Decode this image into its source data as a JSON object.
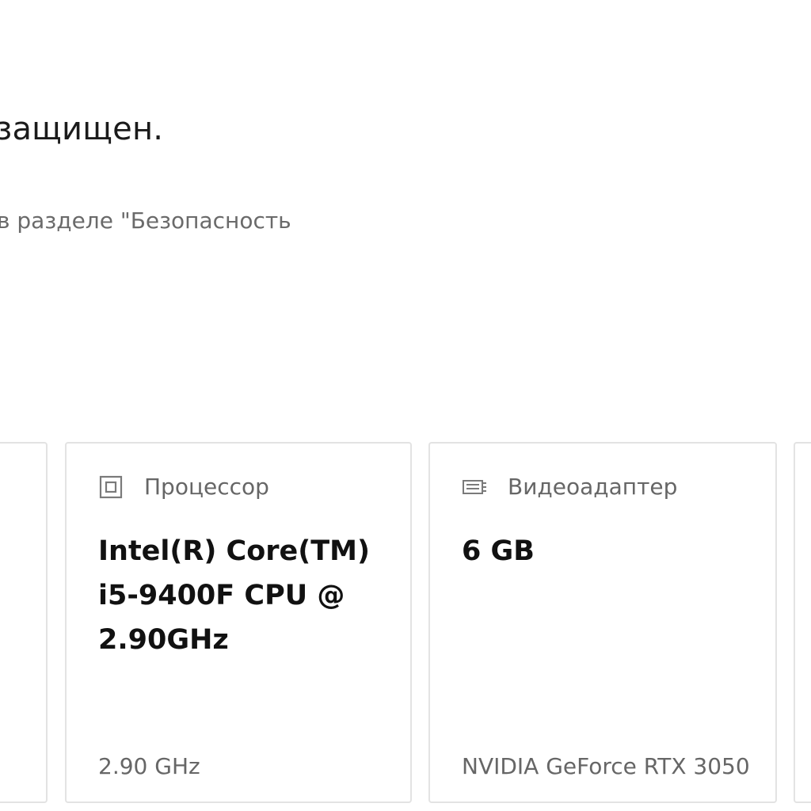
{
  "security": {
    "headline": "защищен.",
    "subtext": "в разделе \"Безопасность"
  },
  "cards": {
    "cpu": {
      "icon": "processor-icon",
      "title": "Процессор",
      "value": "Intel(R) Core(TM) i5-9400F CPU @ 2.90GHz",
      "footer": "2.90 GHz"
    },
    "gpu": {
      "icon": "display-adapter-icon",
      "title": "Видеоадаптер",
      "value": "6 GB",
      "footer": "NVIDIA GeForce RTX 3050"
    }
  }
}
